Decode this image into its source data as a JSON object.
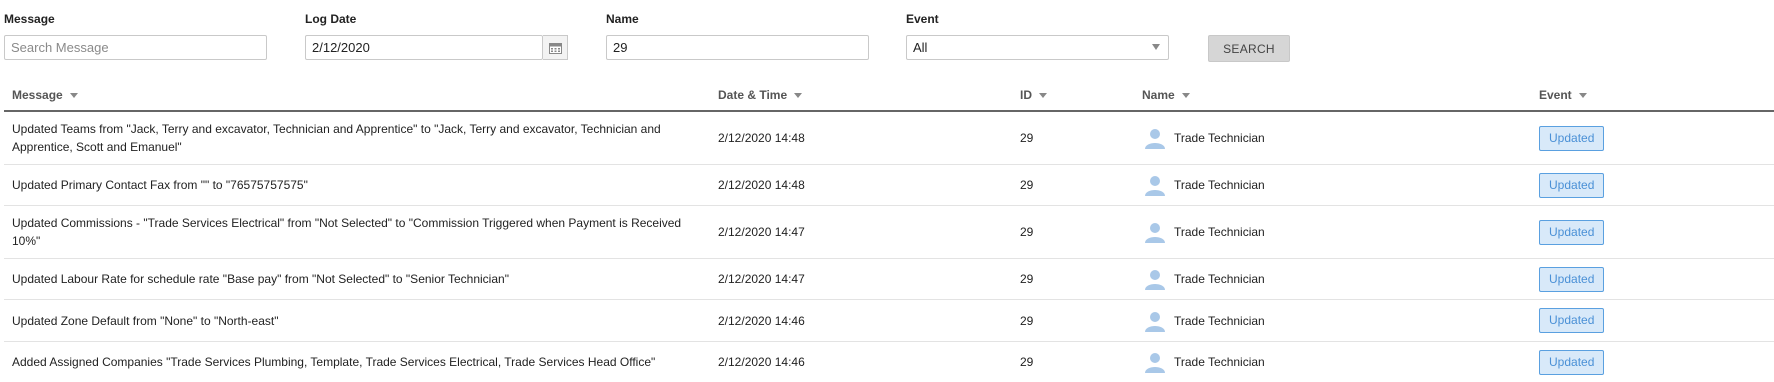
{
  "filters": {
    "message": {
      "label": "Message",
      "placeholder": "Search Message",
      "value": ""
    },
    "log_date": {
      "label": "Log Date",
      "value": "2/12/2020"
    },
    "name": {
      "label": "Name",
      "value": "29"
    },
    "event": {
      "label": "Event",
      "selected": "All"
    },
    "search_label": "SEARCH"
  },
  "grid": {
    "columns": {
      "message": "Message",
      "datetime": "Date & Time",
      "id": "ID",
      "name": "Name",
      "event": "Event"
    },
    "rows": [
      {
        "message": "Updated Teams from \"Jack, Terry and excavator, Technician and Apprentice\" to \"Jack, Terry and excavator, Technician and Apprentice, Scott and Emanuel\"",
        "datetime": "2/12/2020 14:48",
        "id": "29",
        "name": "Trade Technician",
        "event": "Updated"
      },
      {
        "message": "Updated Primary Contact Fax from \"\" to \"76575757575\"",
        "datetime": "2/12/2020 14:48",
        "id": "29",
        "name": "Trade Technician",
        "event": "Updated"
      },
      {
        "message": "Updated Commissions - \"Trade Services Electrical\" from \"Not Selected\" to \"Commission Triggered when Payment is Received 10%\"",
        "datetime": "2/12/2020 14:47",
        "id": "29",
        "name": "Trade Technician",
        "event": "Updated"
      },
      {
        "message": "Updated Labour Rate for schedule rate \"Base pay\" from \"Not Selected\" to \"Senior Technician\"",
        "datetime": "2/12/2020 14:47",
        "id": "29",
        "name": "Trade Technician",
        "event": "Updated"
      },
      {
        "message": "Updated Zone Default from \"None\" to \"North-east\"",
        "datetime": "2/12/2020 14:46",
        "id": "29",
        "name": "Trade Technician",
        "event": "Updated"
      },
      {
        "message": "Added Assigned Companies \"Trade Services Plumbing, Template, Trade Services Electrical, Trade Services Head Office\"",
        "datetime": "2/12/2020 14:46",
        "id": "29",
        "name": "Trade Technician",
        "event": "Updated"
      }
    ]
  },
  "icons": {
    "date_picker": "calendar-icon",
    "dropdown": "chevron-down-icon",
    "sort": "sort-caret-icon",
    "user": "user-avatar-icon"
  },
  "colors": {
    "badge_bg": "#d8e9f9",
    "badge_border": "#5aa0e0",
    "badge_text": "#4a90d6",
    "avatar": "#a9c8e8"
  }
}
